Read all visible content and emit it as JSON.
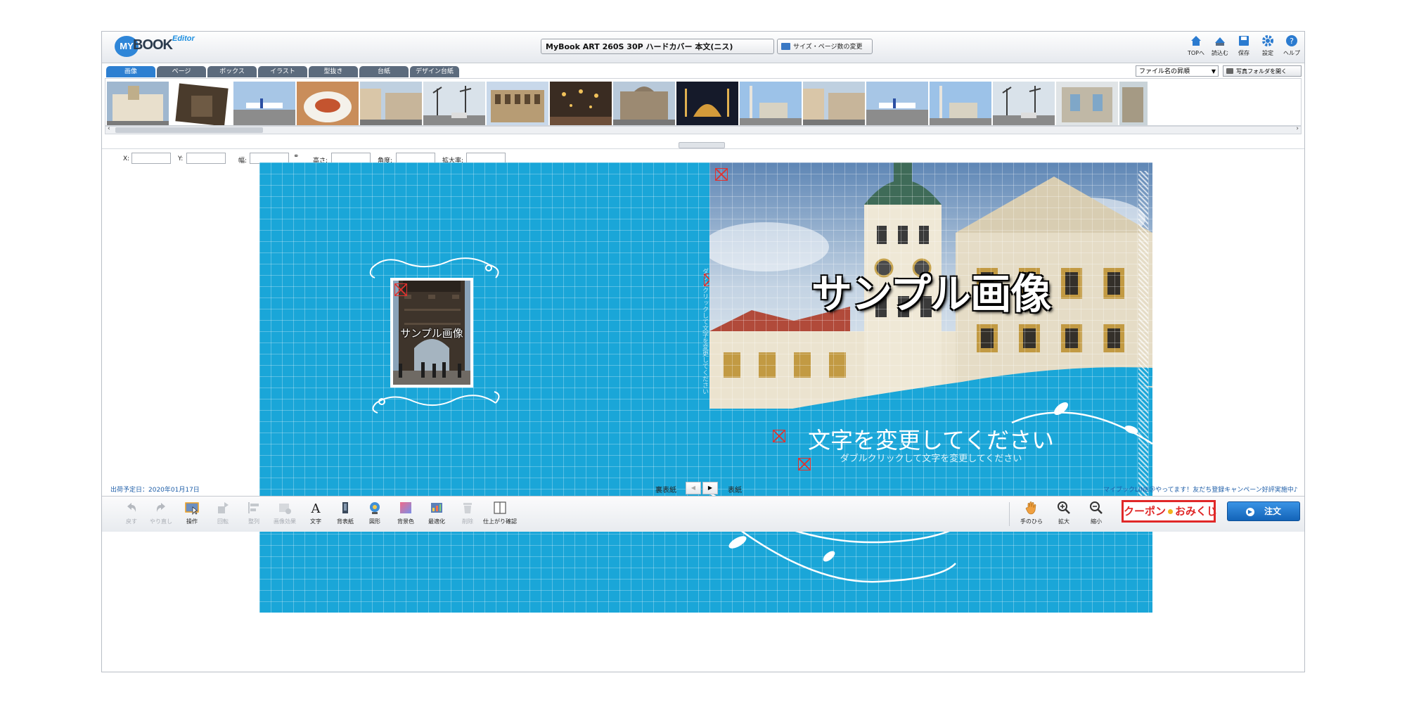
{
  "header": {
    "logo_my": "MY",
    "logo_book": "BOOK",
    "logo_editor": "Editor",
    "product_title": "MyBook ART 260S 30P ハードカバー 本文(ニス)",
    "size_change_label": "サイズ・ページ数の変更",
    "top_buttons": [
      {
        "label": "TOPへ",
        "icon": "home-icon"
      },
      {
        "label": "読込む",
        "icon": "load-icon"
      },
      {
        "label": "保存",
        "icon": "save-icon"
      },
      {
        "label": "設定",
        "icon": "gear-icon"
      },
      {
        "label": "ヘルプ",
        "icon": "help-icon"
      }
    ]
  },
  "material_panel": {
    "tabs": [
      "画像",
      "ページ",
      "ボックス",
      "イラスト",
      "型抜き",
      "台紙",
      "デザイン台紙"
    ],
    "active_tab": "画像",
    "sort_select_value": "ファイル名の昇順",
    "open_folder_label": "写真フォルダを開く"
  },
  "coord_bar": {
    "x_label": "X:",
    "y_label": "Y:",
    "width_label": "幅:",
    "height_label": "高さ:",
    "angle_label": "角度:",
    "zoom_label": "拡大率:"
  },
  "canvas": {
    "sample_image_label": "サンプル画像",
    "sample_image_small_label": "サンプル画像",
    "title_text": "文字を変更してください",
    "subtitle_text": "ダブルクリックして文字を変更してください",
    "spine_text": "ダブルクリックして文字を変更してください"
  },
  "footer": {
    "ship_date": "出荷予定日：2020年01月17日",
    "back_cover_label": "裏表紙",
    "front_cover_label": "表紙",
    "line_campaign": "マイブックLINE＠やってます！友だち登録キャンペーン好評実施中♪"
  },
  "toolbar": {
    "tools": [
      {
        "label": "戻す",
        "enabled": false,
        "icon": "undo-icon"
      },
      {
        "label": "やり直し",
        "enabled": false,
        "icon": "redo-icon"
      },
      {
        "label": "操作",
        "enabled": true,
        "icon": "select-icon"
      },
      {
        "label": "回転",
        "enabled": false,
        "icon": "rotate-icon"
      },
      {
        "label": "整列",
        "enabled": false,
        "icon": "align-icon"
      },
      {
        "label": "画像効果",
        "enabled": false,
        "icon": "image-effect-icon"
      },
      {
        "label": "文字",
        "enabled": true,
        "icon": "text-icon"
      },
      {
        "label": "背表紙",
        "enabled": true,
        "icon": "spine-icon"
      },
      {
        "label": "図形",
        "enabled": true,
        "icon": "shape-icon"
      },
      {
        "label": "背景色",
        "enabled": true,
        "icon": "bg-color-icon"
      },
      {
        "label": "最適化",
        "enabled": true,
        "icon": "optimize-icon"
      },
      {
        "label": "削除",
        "enabled": false,
        "icon": "trash-icon"
      },
      {
        "label": "仕上がり確認",
        "enabled": true,
        "icon": "preview-icon"
      }
    ],
    "hand_label": "手のひら",
    "zoom_in_label": "拡大",
    "zoom_out_label": "縮小",
    "coupon_left": "クーポン",
    "coupon_right": "おみくじ",
    "order_label": "注文"
  },
  "colors": {
    "cover_blue": "#1aa6d8",
    "accent_blue": "#2d7fd1",
    "coupon_red": "#e02828"
  }
}
